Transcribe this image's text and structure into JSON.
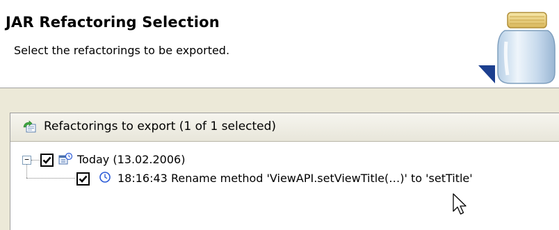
{
  "header": {
    "title": "JAR Refactoring Selection",
    "description": "Select the refactorings to be exported."
  },
  "panel": {
    "label": "Refactorings to export (1 of 1 selected)",
    "icon": "export-refactorings-icon"
  },
  "tree": {
    "group": {
      "label": "Today (13.02.2006)",
      "checked": true,
      "expanded": true,
      "icon": "calendar-history-icon"
    },
    "items": [
      {
        "label": "18:16:43 Rename method 'ViewAPI.setViewTitle(…)' to 'setTitle'",
        "checked": true,
        "icon": "clock-icon"
      }
    ]
  },
  "colors": {
    "header_bg": "#ffffff",
    "body_bg": "#ece9d8",
    "clock_blue": "#2a5ad7"
  }
}
